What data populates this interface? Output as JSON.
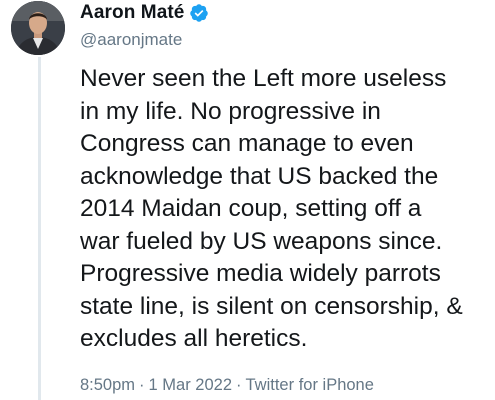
{
  "author": {
    "display_name": "Aaron Maté",
    "handle": "@aaronjmate",
    "verified": true,
    "avatar_icon": "profile-photo",
    "verified_icon": "verified-badge-icon",
    "verified_color": "#1da1f2"
  },
  "tweet": {
    "text": "Never seen the Left more useless\nin my life. No progressive in\nCongress can manage to even\nacknowledge that US backed the\n2014 Maidan coup, setting off a\nwar fueled by US weapons since.\nProgressive media widely parrots\nstate line, is silent on censorship, &\nexcludes all heretics."
  },
  "meta": {
    "time": "8:50pm",
    "separator": "·",
    "date": "1 Mar 2022",
    "source": "Twitter for iPhone"
  }
}
